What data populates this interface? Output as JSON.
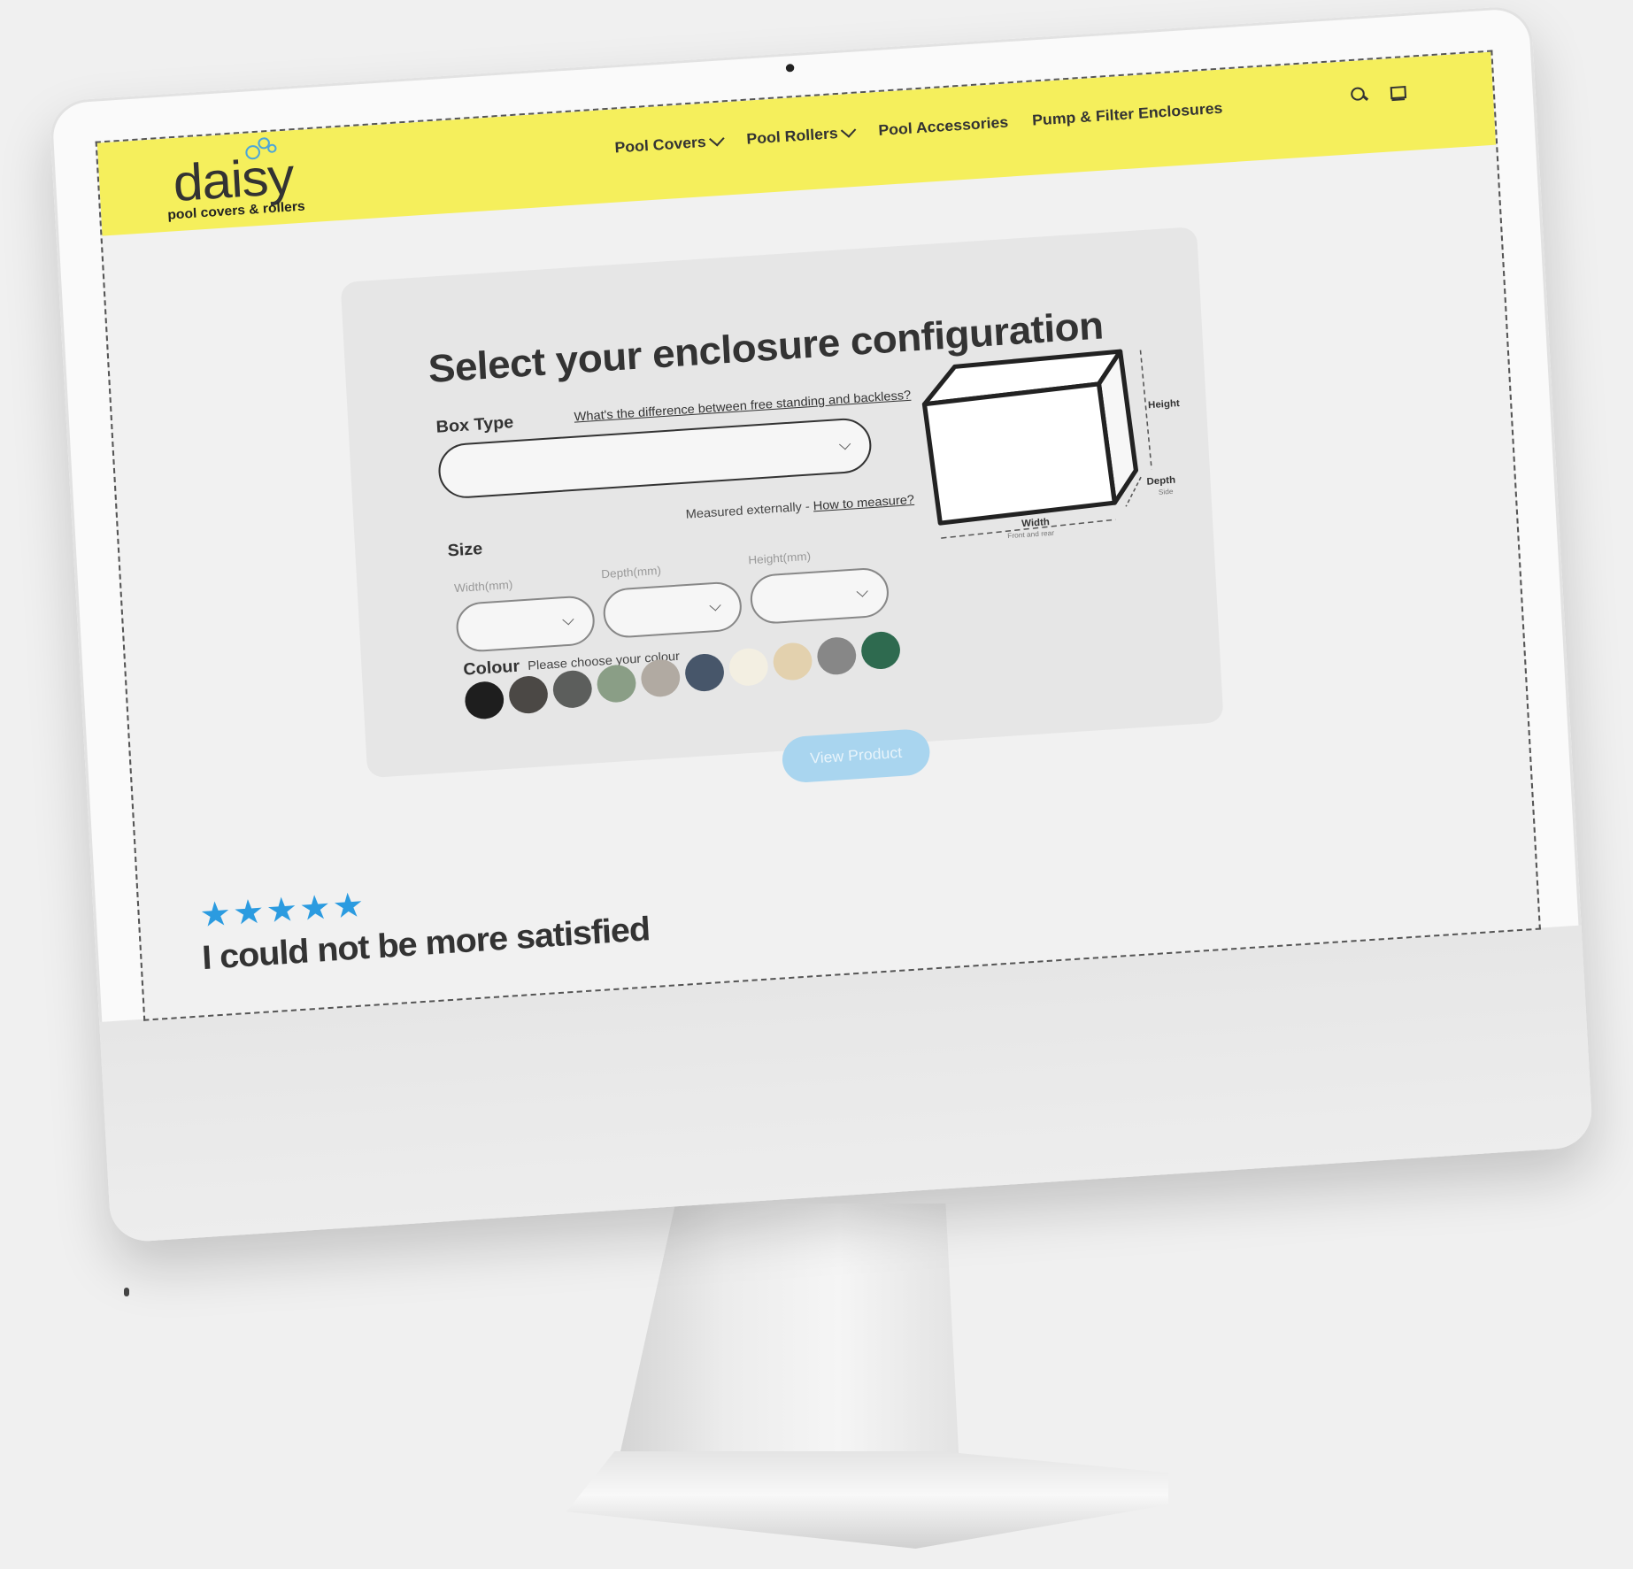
{
  "header": {
    "logo": {
      "word": "daisy",
      "tagline": "pool covers & rollers"
    },
    "nav": [
      {
        "label": "Pool Covers",
        "dropdown": true
      },
      {
        "label": "Pool Rollers",
        "dropdown": true
      },
      {
        "label": "Pool Accessories",
        "dropdown": false
      },
      {
        "label": "Pump & Filter Enclosures",
        "dropdown": false
      }
    ],
    "icons": [
      "search-icon",
      "cart-icon"
    ],
    "color": "#f5ef5c"
  },
  "configurator": {
    "title": "Select your enclosure configuration",
    "box_type": {
      "label": "Box Type",
      "help_link": "What's the difference between free standing and backless?",
      "value": ""
    },
    "size": {
      "label": "Size",
      "note": "Measured externally - ",
      "help_link": "How to measure?",
      "fields": [
        {
          "label": "Width(mm)",
          "value": ""
        },
        {
          "label": "Depth(mm)",
          "value": ""
        },
        {
          "label": "Height(mm)",
          "value": ""
        }
      ]
    },
    "colour": {
      "label": "Colour",
      "hint": "Please choose your colour",
      "swatches": [
        "#1e1e1e",
        "#4b4845",
        "#5c5e5c",
        "#8a9e86",
        "#b1aaa2",
        "#47566a",
        "#f3efe2",
        "#e3d1ae",
        "#878787",
        "#2e6a4f"
      ]
    },
    "diagram": {
      "height": "Height",
      "depth": "Depth",
      "depth_sub": "Side",
      "width": "Width",
      "width_sub": "Front and rear"
    },
    "button": "View Product"
  },
  "review": {
    "stars": "★★★★★",
    "headline": "I could not be more satisfied",
    "star_color": "#2b9be0"
  }
}
